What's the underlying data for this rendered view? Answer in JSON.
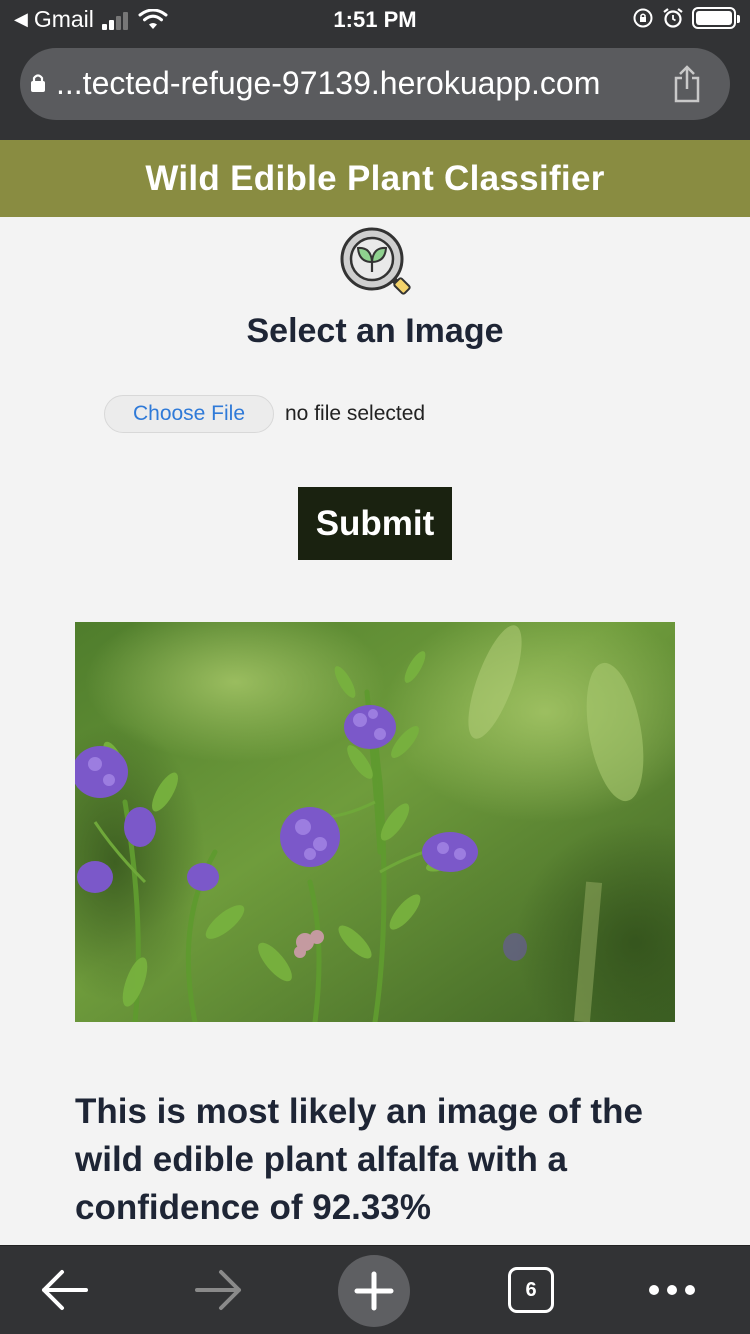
{
  "status_bar": {
    "back_app": "Gmail",
    "time": "1:51 PM"
  },
  "browser": {
    "url": "...tected-refuge-97139.herokuapp.com",
    "tab_count": "6"
  },
  "header": {
    "title": "Wild Edible Plant Classifier",
    "bg_color": "#898c41"
  },
  "form": {
    "title": "Select an Image",
    "choose_file_label": "Choose File",
    "file_status": "no file selected",
    "submit_label": "Submit"
  },
  "result": {
    "text": "This is most likely an image of the wild edible plant alfalfa with a confidence of 92.33%"
  },
  "icons": {
    "logo": "magnifier-leaf-icon",
    "back": "arrow-left-icon",
    "forward": "arrow-right-icon",
    "new_tab": "plus-icon",
    "more": "more-dots-icon"
  }
}
